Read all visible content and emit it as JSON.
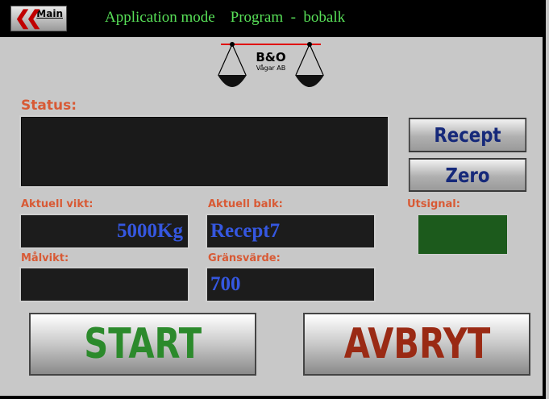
{
  "topbar": {
    "main_button_label": "Main",
    "title": "Application mode    Program  -  bobalk"
  },
  "logo": {
    "brand": "B&O",
    "sub": "Vågar AB"
  },
  "status": {
    "label": "Status:",
    "text": ""
  },
  "buttons": {
    "recept": "Recept",
    "zero": "Zero",
    "start": "START",
    "avbryt": "AVBRYT"
  },
  "fields": {
    "aktuell_vikt_label": "Aktuell vikt:",
    "aktuell_vikt_value": "5000Kg",
    "aktuell_balk_label": "Aktuell balk:",
    "aktuell_balk_value": "Recept7",
    "malvikt_label": "Målvikt:",
    "malvikt_value": "",
    "gransvarde_label": "Gränsvärde:",
    "gransvarde_value": "700",
    "utsignal_label": "Utsignal:"
  },
  "colors": {
    "title_green": "#58e058",
    "label_orange": "#d85a35",
    "value_blue": "#3557e0",
    "start_green": "#2c8a2c",
    "avbryt_red": "#9a2a14",
    "utsignal_led": "#1c5a1c"
  }
}
